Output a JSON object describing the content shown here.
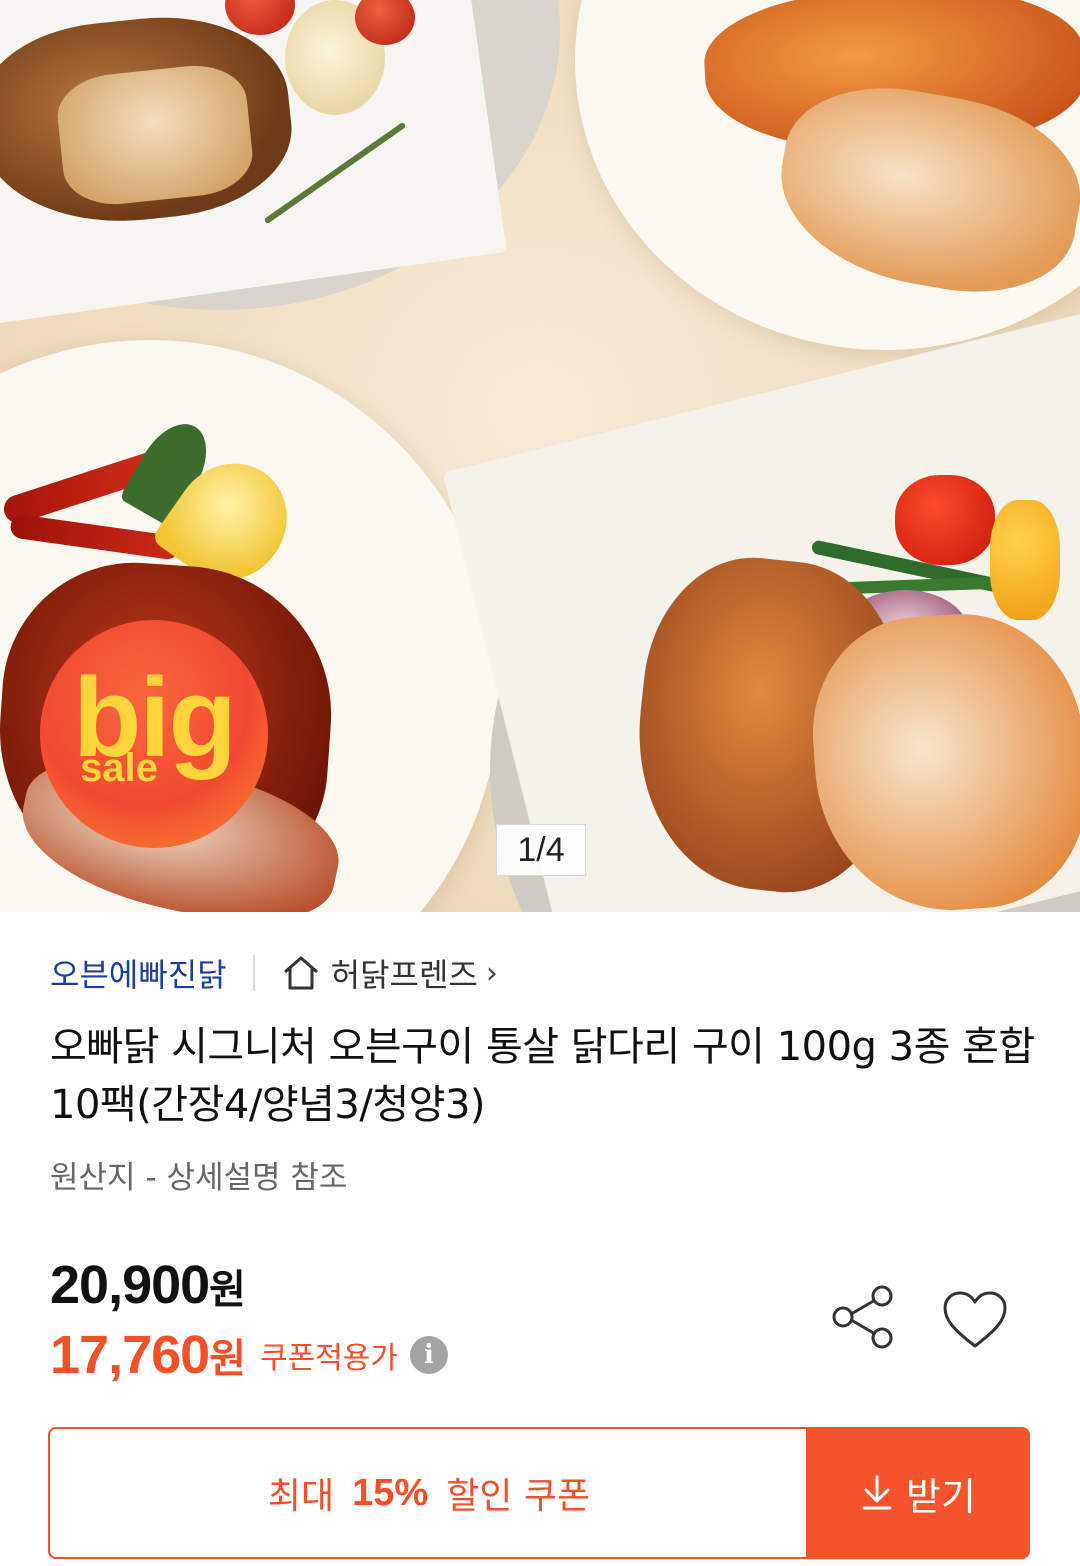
{
  "hero": {
    "badge": {
      "word_big": "big",
      "word_sale": "sale"
    },
    "pager": {
      "current": 1,
      "total": 4,
      "label": "1/4"
    }
  },
  "seller": {
    "brand": "오븐에빠진닭",
    "store_label": "허닭프렌즈",
    "store_icon": "home-icon",
    "chevron": "›"
  },
  "product": {
    "title": "오빠닭 시그니처 오븐구이 통살 닭다리 구이 100g 3종 혼합 10팩(간장4/양념3/청양3)",
    "origin": "원산지 - 상세설명 참조"
  },
  "pricing": {
    "original_amount": "20,900",
    "original_unit": "원",
    "coupon_amount": "17,760",
    "coupon_unit": "원",
    "coupon_note": "쿠폰적용가",
    "info_icon": "i"
  },
  "actions": {
    "share_icon": "share-icon",
    "like_icon": "heart-icon",
    "coupon_prefix": "최대",
    "coupon_percent": "15%",
    "coupon_suffix": "할인 쿠폰",
    "receive_label": "받기",
    "receive_icon": "download-icon"
  },
  "colors": {
    "accent": "#f34f29",
    "brand": "#1b3f9a",
    "badge_text": "#ffd43a"
  }
}
